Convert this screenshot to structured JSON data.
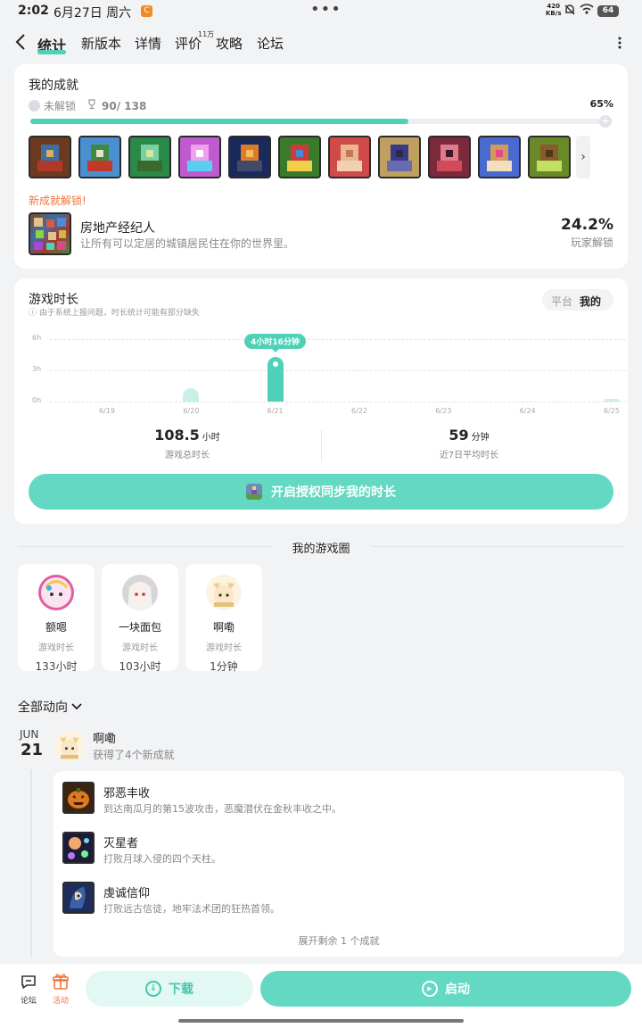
{
  "status_bar": {
    "time": "2:02",
    "date": "6月27日 周六",
    "app_badge": "C",
    "net_speed": "420",
    "net_unit": "KB/s",
    "battery": "64"
  },
  "nav": {
    "tabs": [
      {
        "label": "统计"
      },
      {
        "label": "新版本"
      },
      {
        "label": "详情"
      },
      {
        "label": "评价"
      },
      {
        "label": "攻略"
      },
      {
        "label": "论坛"
      }
    ],
    "review_badge": "11万"
  },
  "achievements": {
    "title": "我的成就",
    "unlocked_label": "未解锁",
    "count": "90/ 138",
    "percent": "65%",
    "progress": 0.65,
    "icons": [
      "achievement-1-icon",
      "achievement-2-icon",
      "achievement-3-icon",
      "achievement-4-icon",
      "achievement-5-icon",
      "achievement-6-icon",
      "achievement-7-icon",
      "achievement-8-icon",
      "achievement-9-icon",
      "achievement-10-icon",
      "achievement-11-icon"
    ],
    "new_label": "新成就解锁!",
    "new_name": "房地产经纪人",
    "new_desc": "让所有可以定居的城镇居民住在你的世界里。",
    "new_rate": "24.2%",
    "new_rate_label": "玩家解锁"
  },
  "playtime": {
    "title": "游戏时长",
    "note": "ⓘ 由于系统上报问题，时长统计可能有部分缺失",
    "toggle": {
      "platform": "平台",
      "mine": "我的"
    },
    "total_value": "108.5",
    "total_unit": "小时",
    "total_label": "游戏总时长",
    "avg_value": "59",
    "avg_unit": "分钟",
    "avg_label": "近7日平均时长",
    "sync_button": "开启授权同步我的时长"
  },
  "chart_data": {
    "type": "bar",
    "categories": [
      "6/19",
      "6/20",
      "6/21",
      "6/22",
      "6/23",
      "6/24",
      "6/25"
    ],
    "values": [
      0,
      1.3,
      4.27,
      0,
      0,
      0,
      0.1
    ],
    "y_ticks": [
      "6h",
      "3h",
      "0h"
    ],
    "ylim": [
      0,
      6
    ],
    "highlight_index": 2,
    "tooltip": "4小时16分钟",
    "grid": true
  },
  "game_circle": {
    "title": "我的游戏圈",
    "friends": [
      {
        "name": "额嗯",
        "label": "游戏时长",
        "value": "133小时"
      },
      {
        "name": "一块面包",
        "label": "游戏时长",
        "value": "103小时"
      },
      {
        "name": "啊嘞",
        "label": "游戏时长",
        "value": "1分钟"
      }
    ]
  },
  "feed": {
    "filter": "全部动向",
    "month": "JUN",
    "day": "21",
    "user": "啊嘞",
    "action": "获得了4个新成就",
    "items": [
      {
        "name": "邪恶丰收",
        "desc": "到达南瓜月的第15波攻击，恶魔潜伏在金秋丰收之中。"
      },
      {
        "name": "灭星者",
        "desc": "打败月球入侵的四个天柱。"
      },
      {
        "name": "虔诚信仰",
        "desc": "打败远古信徒，地牢法术团的狂热首领。"
      }
    ],
    "expand": "展开剩余 1 个成就"
  },
  "bottom": {
    "forum": "论坛",
    "activity": "活动",
    "download": "下载",
    "launch": "启动"
  },
  "colors": {
    "accent": "#4fd1b8",
    "accent_button": "#63d8c3",
    "new_label": "#f0763c"
  }
}
